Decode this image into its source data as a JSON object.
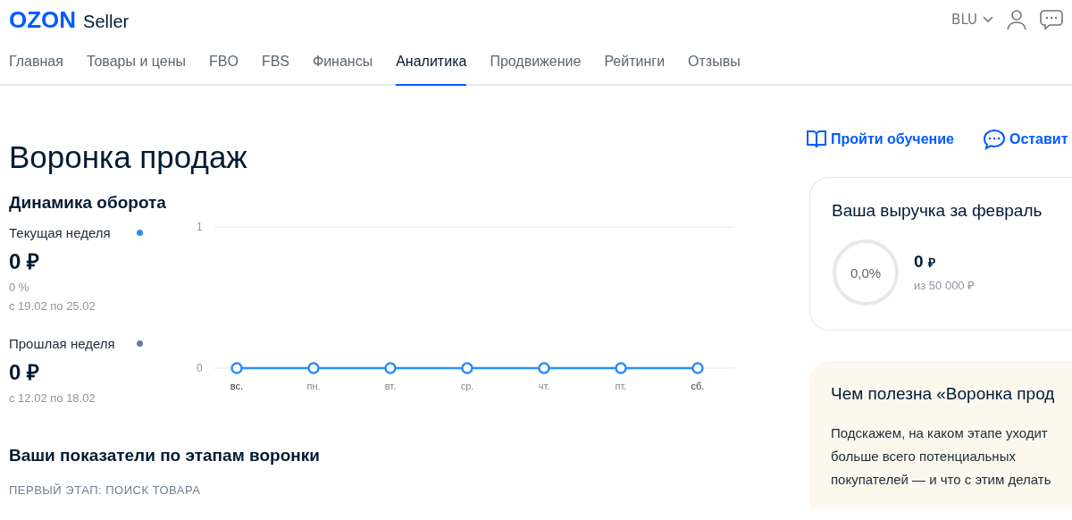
{
  "header": {
    "logo": "OZON",
    "logo_suffix": "Seller",
    "account": "BLU"
  },
  "nav": [
    {
      "label": "Главная",
      "selected": false
    },
    {
      "label": "Товары и цены",
      "selected": false
    },
    {
      "label": "FBO",
      "selected": false
    },
    {
      "label": "FBS",
      "selected": false
    },
    {
      "label": "Финансы",
      "selected": false
    },
    {
      "label": "Аналитика",
      "selected": true
    },
    {
      "label": "Продвижение",
      "selected": false
    },
    {
      "label": "Рейтинги",
      "selected": false
    },
    {
      "label": "Отзывы",
      "selected": false
    }
  ],
  "page": {
    "title": "Воронка продаж",
    "actions": [
      {
        "kind": "book",
        "label": "Пройти обучение"
      },
      {
        "kind": "chat",
        "label": "Оставит"
      }
    ]
  },
  "turnover": {
    "title": "Динамика оборота",
    "weeks": [
      {
        "label": "Текущая неделя",
        "color": "#2b8ff5",
        "amount": "0 ₽",
        "change": "0 %",
        "range": "с 19.02 по 25.02"
      },
      {
        "label": "Прошлая неделя",
        "color": "#6e7a8a",
        "amount": "0 ₽",
        "range": "с 12.02 по 18.02"
      }
    ],
    "chart_data": {
      "type": "line",
      "categories": [
        "вс.",
        "пн.",
        "вт.",
        "ср.",
        "чт.",
        "пт.",
        "сб."
      ],
      "series": [
        {
          "color": "#2b8ff5",
          "marker": "circle",
          "values": [
            0,
            0,
            0,
            0,
            0,
            0,
            0
          ]
        }
      ],
      "ylim": [
        0,
        1
      ],
      "yticks": [
        0,
        1
      ]
    }
  },
  "funnel": {
    "title": "Ваши показатели по этапам воронки",
    "stage": "ПЕРВЫЙ ЭТАП: ПОИСК ТОВАРА"
  },
  "revenue": {
    "title": "Ваша выручка за февраль",
    "percent": "0,0%",
    "amount": "0",
    "currency": "₽",
    "target": "из 50 000 ₽"
  },
  "info": {
    "title": "Чем полезна «Воронка прод",
    "lines": [
      "Подскажем, на каком этапе уходит",
      "больше всего потенциальных",
      "покупателей — и что с этим делать"
    ]
  }
}
